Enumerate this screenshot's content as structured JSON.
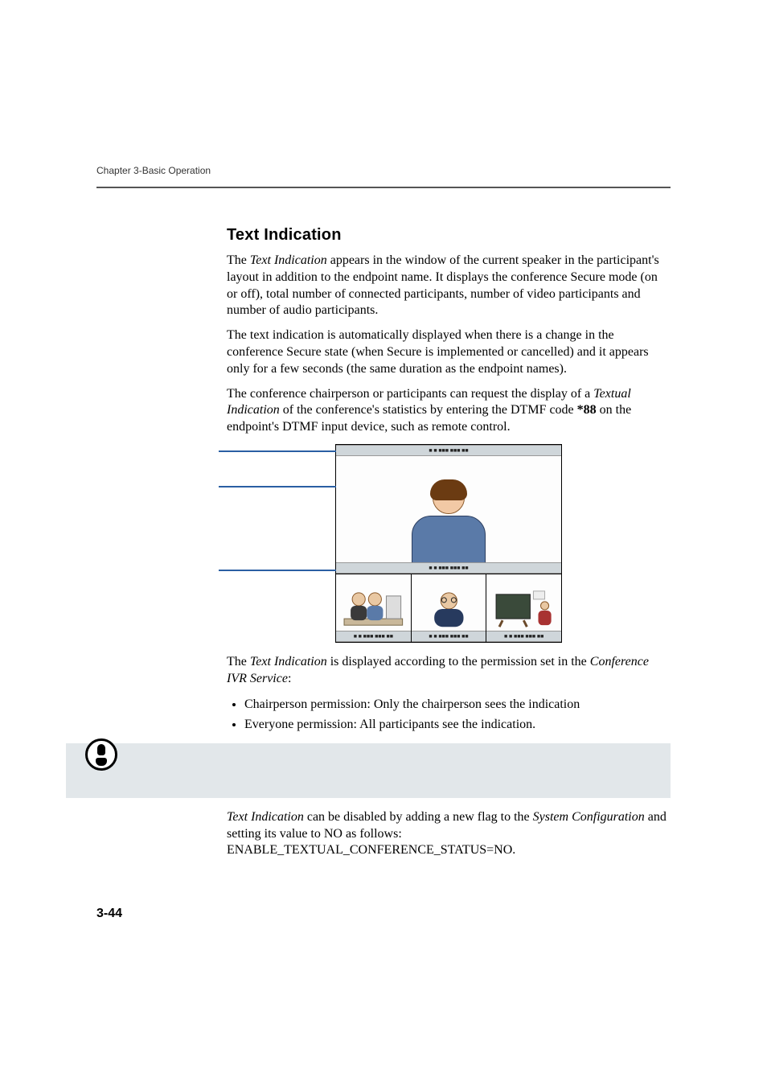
{
  "running_head": "Chapter 3-Basic Operation",
  "heading": "Text Indication",
  "para1_pre": "The ",
  "para1_em": "Text Indication",
  "para1_post": " appears in the window of the current speaker in the participant's layout in addition to the endpoint name. It displays the conference Secure mode (on or off), total number of connected participants, number of video participants and number of audio participants.",
  "para2": "The text indication is automatically displayed when there is a change in the conference Secure state (when Secure is implemented or cancelled) and it appears only for a few seconds (the same duration as the endpoint names).",
  "para3_a": "The conference chairperson or participants can request the display of a ",
  "para3_em": "Textual Indication",
  "para3_b": " of the conference's statistics by entering the DTMF code ",
  "para3_bold": "*88",
  "para3_c": " on the endpoint's DTMF input device, such as remote control.",
  "fig_bar_text": "■ ■  ■■■  ■■■  ■■",
  "para4_a": "The ",
  "para4_em": "Text Indication",
  "para4_b": " is displayed according to the permission set in the ",
  "para4_em2": "Conference IVR Service",
  "para4_c": ":",
  "bullets": [
    "Chairperson permission: Only the chairperson sees the indication",
    "Everyone permission: All participants see the indication."
  ],
  "para5_em1": "Text Indication",
  "para5_a": " can be disabled by adding a new flag to the ",
  "para5_em2": "System Configuration",
  "para5_b": " and setting its value to NO as follows: ENABLE_TEXTUAL_CONFERENCE_STATUS=NO.",
  "page_number": "3-44"
}
